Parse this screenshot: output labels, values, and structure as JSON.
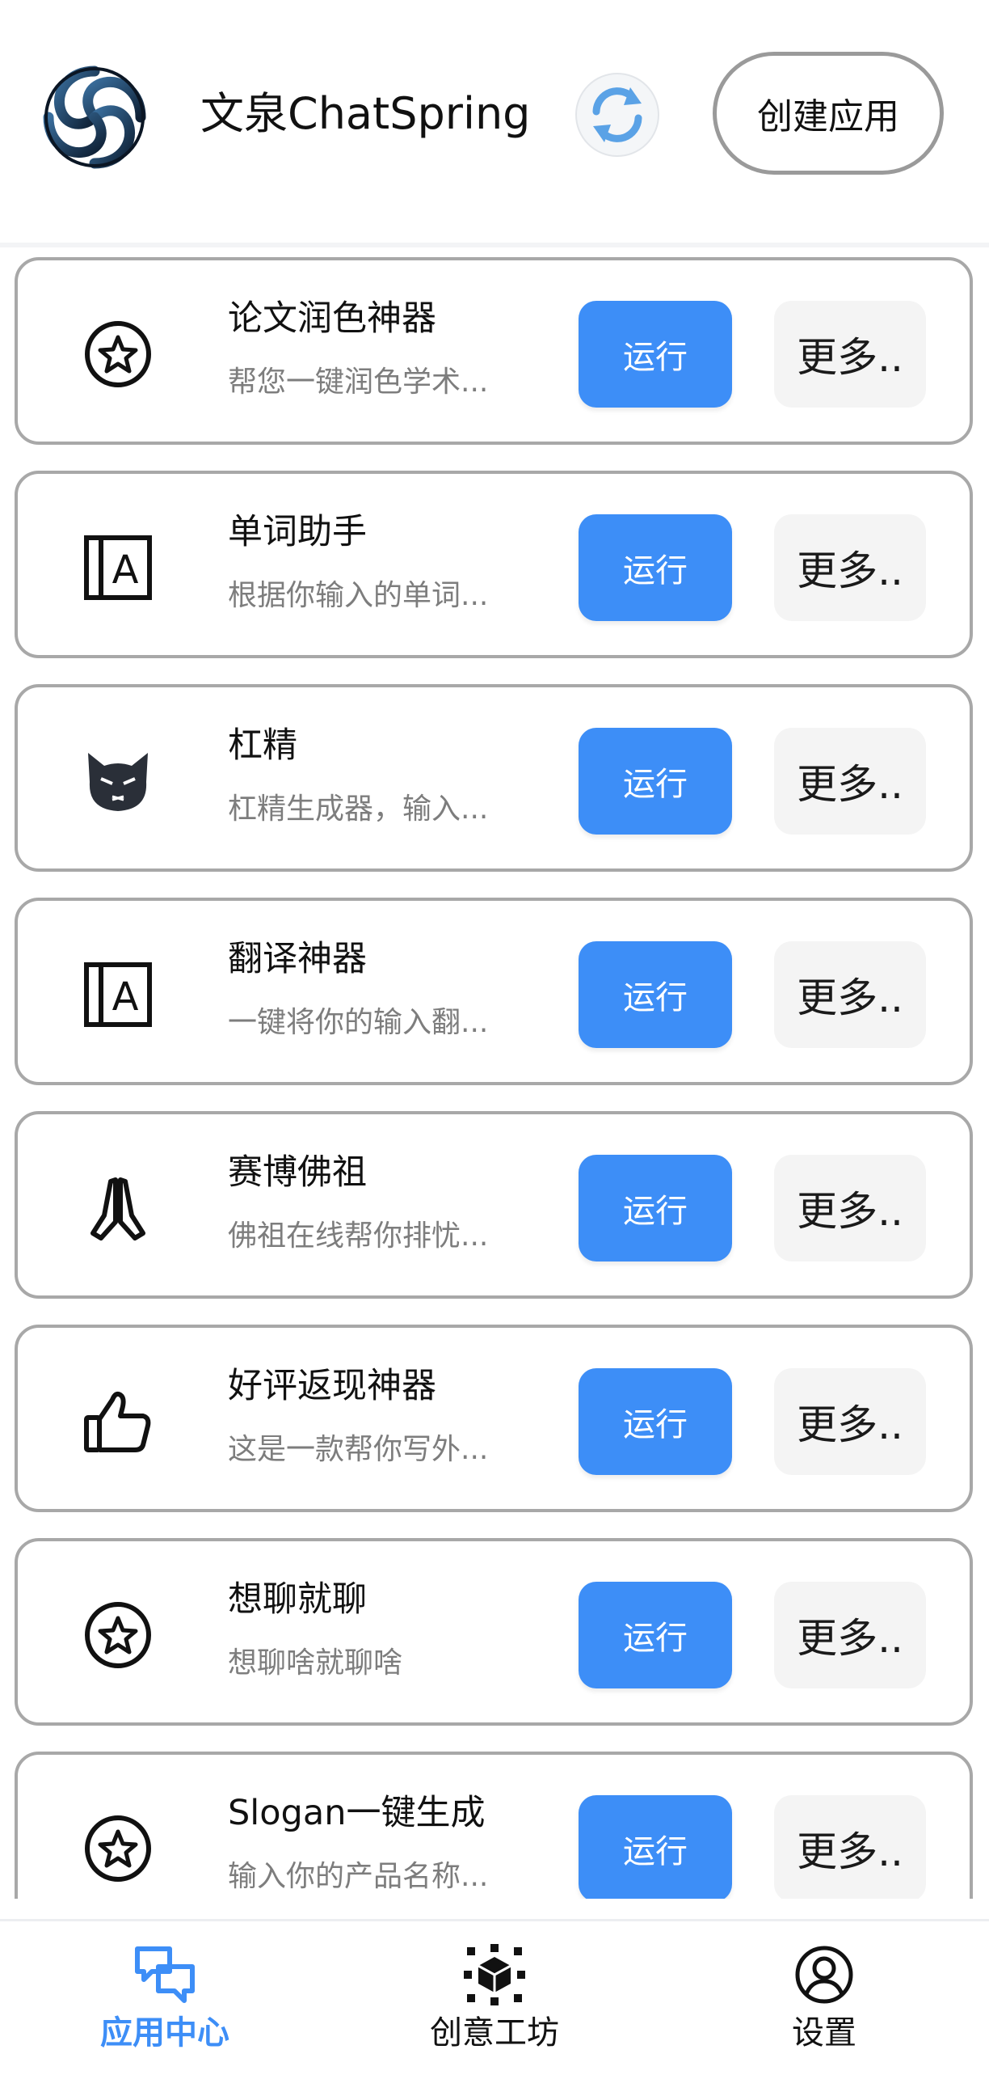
{
  "header": {
    "app_title": "文泉ChatSpring",
    "logo_icon": "knot-logo-icon",
    "refresh_icon": "refresh-icon",
    "create_button": "创建应用"
  },
  "apps": [
    {
      "title": "论文润色神器",
      "desc": "帮您一键润色学术...",
      "icon": "star-circle-icon",
      "run": "运行",
      "more": "更多.."
    },
    {
      "title": "单词助手",
      "desc": "根据你输入的单词...",
      "icon": "letter-a-book-icon",
      "run": "运行",
      "more": "更多.."
    },
    {
      "title": "杠精",
      "desc": "杠精生成器，输入...",
      "icon": "cat-face-icon",
      "run": "运行",
      "more": "更多.."
    },
    {
      "title": "翻译神器",
      "desc": "一键将你的输入翻...",
      "icon": "letter-a-book-icon",
      "run": "运行",
      "more": "更多.."
    },
    {
      "title": "赛博佛祖",
      "desc": "佛祖在线帮你排忧...",
      "icon": "praying-hands-icon",
      "run": "运行",
      "more": "更多.."
    },
    {
      "title": "好评返现神器",
      "desc": "这是一款帮你写外...",
      "icon": "thumbs-up-icon",
      "run": "运行",
      "more": "更多.."
    },
    {
      "title": "想聊就聊",
      "desc": "想聊啥就聊啥",
      "icon": "star-circle-icon",
      "run": "运行",
      "more": "更多.."
    },
    {
      "title": "Slogan一键生成",
      "desc": "输入你的产品名称...",
      "icon": "star-circle-icon",
      "run": "运行",
      "more": "更多.."
    }
  ],
  "nav": {
    "items": [
      {
        "label": "应用中心",
        "icon": "chat-bubbles-icon",
        "active": true
      },
      {
        "label": "创意工坊",
        "icon": "cube-network-icon",
        "active": false
      },
      {
        "label": "设置",
        "icon": "user-circle-icon",
        "active": false
      }
    ]
  },
  "colors": {
    "accent": "#3d8ef7",
    "border": "#a8a8a8",
    "desc_text": "#7d7d7d",
    "more_bg": "#f4f4f4"
  }
}
